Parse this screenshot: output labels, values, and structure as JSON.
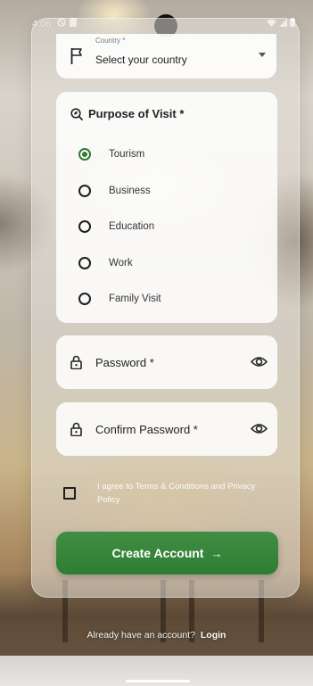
{
  "status_bar": {
    "time": "4:06"
  },
  "country": {
    "floating_label": "Country *",
    "value": "Select your country"
  },
  "purpose": {
    "title": "Purpose of Visit *",
    "options": [
      {
        "label": "Tourism",
        "selected": true
      },
      {
        "label": "Business",
        "selected": false
      },
      {
        "label": "Education",
        "selected": false
      },
      {
        "label": "Work",
        "selected": false
      },
      {
        "label": "Family Visit",
        "selected": false
      }
    ]
  },
  "password": {
    "label": "Password *"
  },
  "confirm_password": {
    "label": "Confirm Password *"
  },
  "terms": {
    "text": "I agree to Terms & Conditions and Privacy Policy",
    "checked": false
  },
  "create_button": {
    "label": "Create Account",
    "arrow": "→"
  },
  "login": {
    "prompt": "Already have an account?",
    "link": "Login"
  },
  "colors": {
    "primary_green": "#2e7d32"
  },
  "icons": {
    "country": "flag-icon",
    "purpose": "explore-icon",
    "password": "lock-icon",
    "visibility": "eye-icon"
  }
}
